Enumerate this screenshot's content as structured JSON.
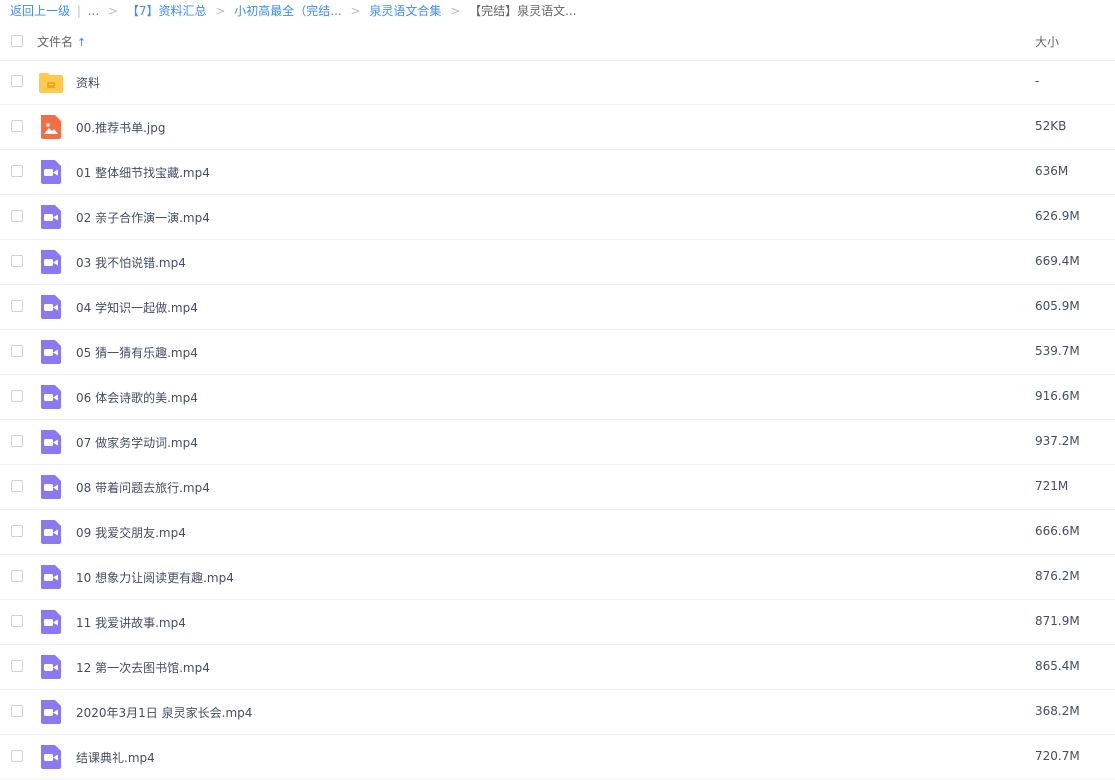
{
  "breadcrumb": {
    "back": "返回上一级",
    "divider": "|",
    "ellipsis": "...",
    "sep": ">",
    "crumbs": [
      "【7】资料汇总",
      "小初高最全（完结...",
      "泉灵语文合集"
    ],
    "current": "【完结】泉灵语文..."
  },
  "header": {
    "name_label": "文件名",
    "sort_arrow": "↑",
    "size_label": "大小"
  },
  "files": [
    {
      "name": "资料",
      "size": "-",
      "icon": "folder-icon"
    },
    {
      "name": "00.推荐书单.jpg",
      "size": "52KB",
      "icon": "image-icon"
    },
    {
      "name": "01 整体细节找宝藏.mp4",
      "size": "636M",
      "icon": "video-icon"
    },
    {
      "name": "02 亲子合作演一演.mp4",
      "size": "626.9M",
      "icon": "video-icon"
    },
    {
      "name": "03 我不怕说错.mp4",
      "size": "669.4M",
      "icon": "video-icon"
    },
    {
      "name": "04 学知识一起做.mp4",
      "size": "605.9M",
      "icon": "video-icon"
    },
    {
      "name": "05 猜一猜有乐趣.mp4",
      "size": "539.7M",
      "icon": "video-icon"
    },
    {
      "name": "06 体会诗歌的美.mp4",
      "size": "916.6M",
      "icon": "video-icon"
    },
    {
      "name": "07 做家务学动词.mp4",
      "size": "937.2M",
      "icon": "video-icon"
    },
    {
      "name": "08 带着问题去旅行.mp4",
      "size": "721M",
      "icon": "video-icon"
    },
    {
      "name": "09 我爱交朋友.mp4",
      "size": "666.6M",
      "icon": "video-icon"
    },
    {
      "name": "10 想象力让阅读更有趣.mp4",
      "size": "876.2M",
      "icon": "video-icon"
    },
    {
      "name": "11 我爱讲故事.mp4",
      "size": "871.9M",
      "icon": "video-icon"
    },
    {
      "name": "12 第一次去图书馆.mp4",
      "size": "865.4M",
      "icon": "video-icon"
    },
    {
      "name": "2020年3月1日 泉灵家长会.mp4",
      "size": "368.2M",
      "icon": "video-icon"
    },
    {
      "name": "结课典礼.mp4",
      "size": "720.7M",
      "icon": "video-icon"
    }
  ],
  "colors": {
    "link": "#3b8cff",
    "folder": "#ffc94d",
    "image_icon": "#f46d43",
    "video_icon": "#8b79f2"
  }
}
